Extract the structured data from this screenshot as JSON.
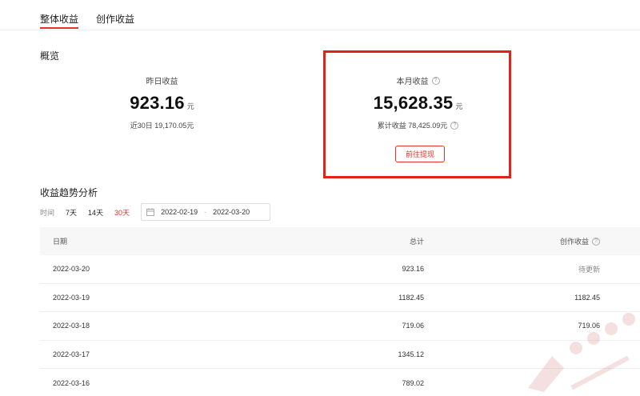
{
  "tabs": [
    {
      "label": "整体收益"
    },
    {
      "label": "创作收益"
    }
  ],
  "overview": {
    "title": "概览",
    "yesterday": {
      "label": "昨日收益",
      "value": "923.16",
      "unit": "元",
      "sub": "近30日 19,170.05元"
    },
    "month": {
      "label": "本月收益",
      "value": "15,628.35",
      "unit": "元",
      "sub": "累计收益 78,425.09元"
    },
    "withdraw_label": "前往提现"
  },
  "trend": {
    "title": "收益趋势分析",
    "time_label": "时间",
    "ranges": [
      "7天",
      "14天",
      "30天"
    ],
    "date_start": "2022-02-19",
    "date_sep": "-",
    "date_end": "2022-03-20"
  },
  "table": {
    "headers": {
      "date": "日期",
      "total": "总计",
      "creation": "创作收益"
    },
    "rows": [
      {
        "date": "2022-03-20",
        "total": "923.16",
        "creation": "待更新"
      },
      {
        "date": "2022-03-19",
        "total": "1182.45",
        "creation": "1182.45"
      },
      {
        "date": "2022-03-18",
        "total": "719.06",
        "creation": "719.06"
      },
      {
        "date": "2022-03-17",
        "total": "1345.12",
        "creation": ""
      },
      {
        "date": "2022-03-16",
        "total": "789.02",
        "creation": ""
      }
    ]
  },
  "colors": {
    "accent": "#e2332f",
    "highlight": "#e0221b"
  }
}
